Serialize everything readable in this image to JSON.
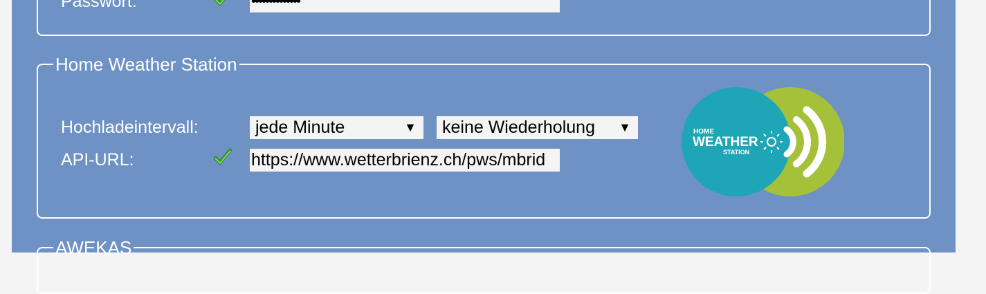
{
  "account_section": {
    "password_label": "Passwort:",
    "password_value": "••••••••••••••"
  },
  "hws_section": {
    "legend": "Home Weather Station",
    "interval_label": "Hochladeintervall:",
    "interval_select": "jede Minute",
    "repeat_select": "keine Wiederholung",
    "api_url_label": "API-URL:",
    "api_url_value": "https://www.wetterbrienz.ch/pws/mbrid",
    "logo": {
      "line1": "HOME",
      "line2": "WEATHER",
      "line3": "STATION"
    }
  },
  "awekas_section": {
    "legend": "AWEKAS"
  },
  "icons": {
    "valid": "checkmark-icon",
    "dropdown": "triangle-down-icon"
  },
  "colors": {
    "panel": "#6f92c4",
    "teal": "#1ea6b6",
    "green": "#a5c13a",
    "check": "#3fae2a"
  }
}
